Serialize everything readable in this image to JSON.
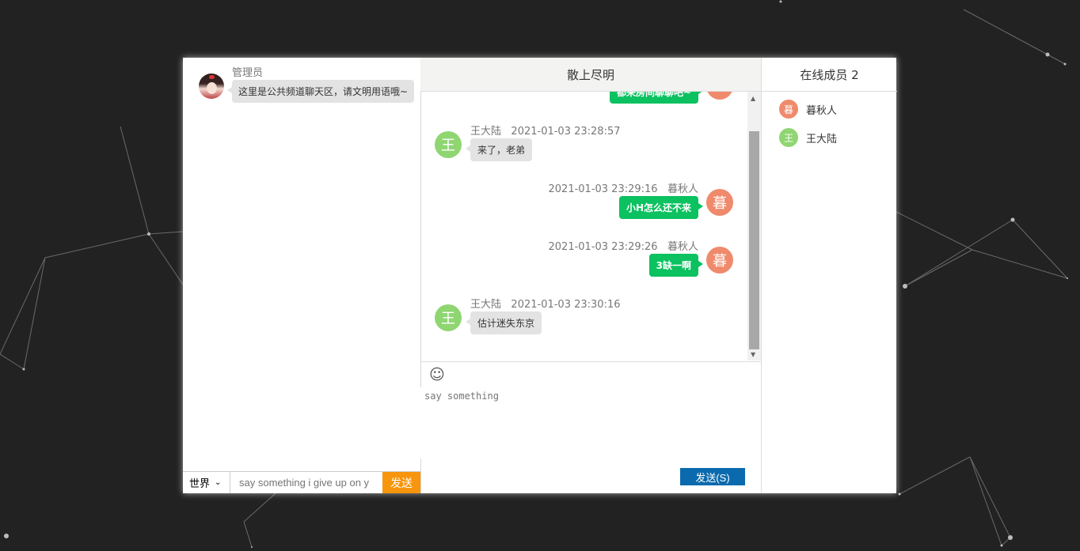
{
  "colors": {
    "page_bg": "#222222",
    "accent_orange": "#f7950d",
    "accent_blue": "#0a6aad",
    "own_bubble": "#0bc160",
    "avatar_mu": "#f08a6c",
    "avatar_wang": "#8fd672"
  },
  "world": {
    "message": {
      "name": "管理员",
      "text": "这里是公共频道聊天区，请文明用语哦~"
    },
    "channel_select": "世界",
    "input_placeholder": "say something i give up on y",
    "send_label": "发送"
  },
  "chat": {
    "title": "散上尽明",
    "partial_top_text": "都来房间聊聊吧~",
    "messages": [
      {
        "side": "left",
        "sender": "王大陆",
        "avatar_char": "王",
        "time": "2021-01-03 23:28:57",
        "text": "来了，老弟"
      },
      {
        "side": "right",
        "sender": "暮秋人",
        "avatar_char": "暮",
        "time": "2021-01-03 23:29:16",
        "text": "小H怎么还不来"
      },
      {
        "side": "right",
        "sender": "暮秋人",
        "avatar_char": "暮",
        "time": "2021-01-03 23:29:26",
        "text": "3缺一啊"
      },
      {
        "side": "left",
        "sender": "王大陆",
        "avatar_char": "王",
        "time": "2021-01-03 23:30:16",
        "text": "估计迷失东京"
      }
    ],
    "emoji_icon": "smiley-icon",
    "input_placeholder": "say something",
    "send_label": "发送(S)"
  },
  "members": {
    "title": "在线成员 2",
    "list": [
      {
        "avatar_char": "暮",
        "name": "暮秋人"
      },
      {
        "avatar_char": "王",
        "name": "王大陆"
      }
    ]
  }
}
